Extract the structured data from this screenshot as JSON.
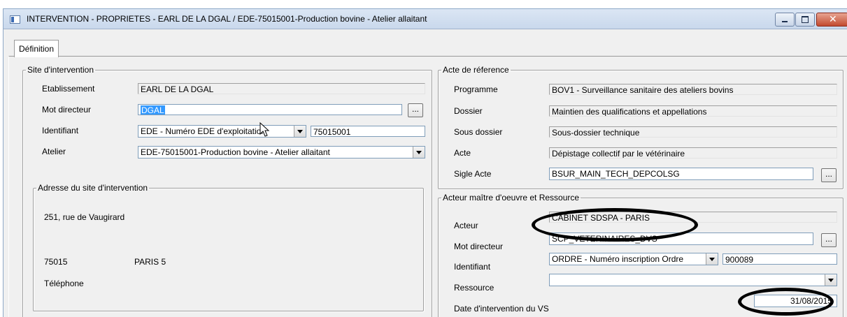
{
  "window": {
    "title": "INTERVENTION - PROPRIETES - EARL DE LA DGAL / EDE-75015001-Production bovine - Atelier allaitant",
    "close_glyph": "✕"
  },
  "tabs": [
    "Définition"
  ],
  "site": {
    "legend": "Site d'intervention",
    "etablissement_label": "Etablissement",
    "etablissement_value": "EARL DE LA DGAL",
    "mot_directeur_label": "Mot directeur",
    "mot_directeur_value": "DGAL",
    "identifiant_label": "Identifiant",
    "identifiant_type": "EDE - Numéro EDE d'exploitation",
    "identifiant_value": "75015001",
    "atelier_label": "Atelier",
    "atelier_value": "EDE-75015001-Production bovine - Atelier allaitant",
    "ellipsis": "..."
  },
  "address": {
    "legend": "Adresse du site d'intervention",
    "street": "251, rue de Vaugirard",
    "postcode": "75015",
    "city": "PARIS 5",
    "phone_label": "Téléphone"
  },
  "acte": {
    "legend": "Acte de réference",
    "programme_label": "Programme",
    "programme_value": "BOV1 - Surveillance sanitaire des ateliers bovins",
    "dossier_label": "Dossier",
    "dossier_value": "Maintien des qualifications et appellations",
    "sous_dossier_label": "Sous dossier",
    "sous_dossier_value": "Sous-dossier technique",
    "acte_label": "Acte",
    "acte_value": "Dépistage collectif par le vétérinaire",
    "sigle_label": "Sigle Acte",
    "sigle_value": "BSUR_MAIN_TECH_DEPCOLSG",
    "ellipsis": "..."
  },
  "acteur": {
    "legend": "Acteur maître d'oeuvre et Ressource",
    "acteur_label": "Acteur",
    "acteur_value": "CABINET SDSPA - PARIS",
    "mot_directeur_label": "Mot directeur",
    "mot_directeur_value": "SCP_VETERINAIRES_DVS",
    "identifiant_label": "Identifiant",
    "identifiant_type": "ORDRE - Numéro inscription Ordre",
    "identifiant_value": "900089",
    "ressource_label": "Ressource",
    "ressource_value": "",
    "date_label": "Date d'intervention du VS",
    "date_value": "31/08/2015",
    "ellipsis": "..."
  }
}
